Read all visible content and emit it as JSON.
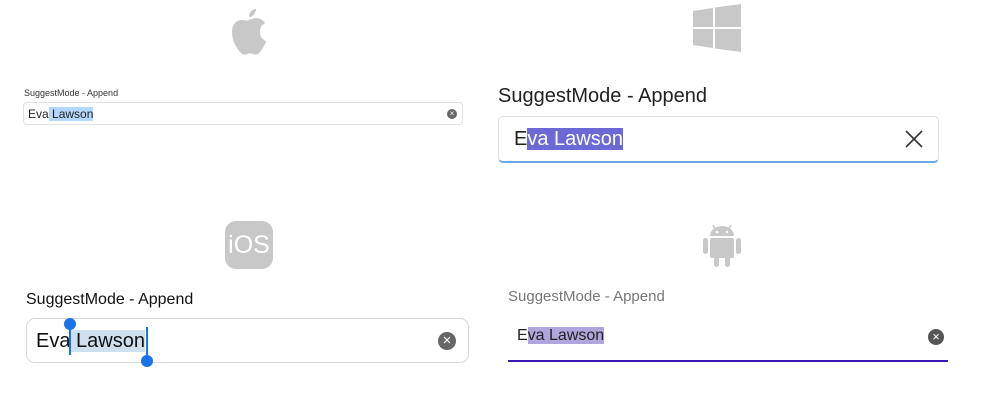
{
  "panels": {
    "macos": {
      "platform_icon": "apple-logo-icon",
      "label": "SuggestMode - Append",
      "typed": "Eva",
      "suggested": " Lawson",
      "clear_icon": "clear-circle-icon",
      "selection_color": "#b3d7ff"
    },
    "windows": {
      "platform_icon": "windows-logo-icon",
      "label": "SuggestMode - Append",
      "typed": "E",
      "suggested": "va Lawson",
      "clear_icon": "close-x-icon",
      "selection_color": "#6b69d6"
    },
    "ios": {
      "platform_icon": "ios-logo-icon",
      "logo_text": "iOS",
      "label": "SuggestMode - Append",
      "typed": "Eva",
      "suggested": " Lawson",
      "clear_icon": "clear-circle-icon",
      "selection_color": "#cde0f0",
      "handle_color": "#1a73e8"
    },
    "android": {
      "platform_icon": "android-logo-icon",
      "label": "SuggestMode - Append",
      "typed": "E",
      "suggested": "va Lawson",
      "clear_icon": "clear-circle-icon",
      "selection_color": "#b1a5dd",
      "underline_color": "#3a17b5"
    }
  }
}
